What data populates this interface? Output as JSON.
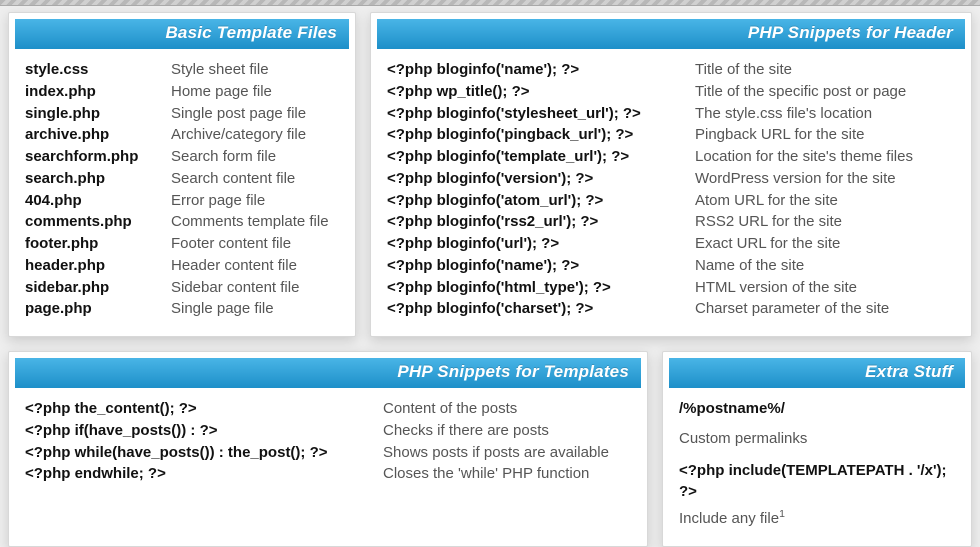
{
  "cards": {
    "basic": {
      "title": "Basic Template Files",
      "rows": [
        {
          "a": "style.css",
          "b": "Style sheet file"
        },
        {
          "a": "index.php",
          "b": "Home page file"
        },
        {
          "a": "single.php",
          "b": "Single post page file"
        },
        {
          "a": "archive.php",
          "b": "Archive/category file"
        },
        {
          "a": "searchform.php",
          "b": "Search form file"
        },
        {
          "a": "search.php",
          "b": "Search content file"
        },
        {
          "a": "404.php",
          "b": "Error page file"
        },
        {
          "a": "comments.php",
          "b": "Comments template file"
        },
        {
          "a": "footer.php",
          "b": "Footer content file"
        },
        {
          "a": "header.php",
          "b": "Header content file"
        },
        {
          "a": "sidebar.php",
          "b": "Sidebar content file"
        },
        {
          "a": "page.php",
          "b": "Single page file"
        }
      ]
    },
    "header": {
      "title": "PHP Snippets for Header",
      "rows": [
        {
          "a": "<?php bloginfo('name'); ?>",
          "b": "Title of the site"
        },
        {
          "a": "<?php wp_title(); ?>",
          "b": "Title of the specific post or page"
        },
        {
          "a": "<?php bloginfo('stylesheet_url'); ?>",
          "b": "The style.css file's location"
        },
        {
          "a": "<?php bloginfo('pingback_url'); ?>",
          "b": "Pingback URL for the site"
        },
        {
          "a": "<?php bloginfo('template_url'); ?>",
          "b": "Location for the site's theme files"
        },
        {
          "a": "<?php bloginfo('version'); ?>",
          "b": "WordPress version for the site"
        },
        {
          "a": "<?php bloginfo('atom_url'); ?>",
          "b": "Atom URL for the site"
        },
        {
          "a": "<?php bloginfo('rss2_url'); ?>",
          "b": "RSS2 URL for the site"
        },
        {
          "a": "<?php bloginfo('url'); ?>",
          "b": "Exact URL for the site"
        },
        {
          "a": "<?php bloginfo('name'); ?>",
          "b": "Name of the site"
        },
        {
          "a": "<?php bloginfo('html_type'); ?>",
          "b": "HTML version of the site"
        },
        {
          "a": "<?php bloginfo('charset'); ?>",
          "b": "Charset parameter of the site"
        }
      ]
    },
    "templates": {
      "title": "PHP Snippets for Templates",
      "rows": [
        {
          "a": "<?php the_content(); ?>",
          "b": "Content of the posts"
        },
        {
          "a": "<?php if(have_posts()) : ?>",
          "b": "Checks if there are posts"
        },
        {
          "a": "<?php while(have_posts()) : the_post(); ?>",
          "b": "Shows posts if posts are available"
        },
        {
          "a": "<?php endwhile; ?>",
          "b": "Closes the 'while' PHP function"
        }
      ]
    },
    "extra": {
      "title": "Extra Stuff",
      "lines": [
        "/%postname%/",
        "Custom permalinks",
        "<?php include(TEMPLATEPATH . '/x'); ?>",
        "Include any file"
      ],
      "footnote_mark": "1"
    }
  }
}
